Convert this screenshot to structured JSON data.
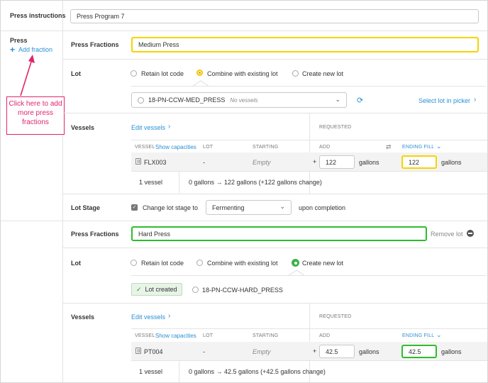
{
  "press_instructions": {
    "label": "Press instructions",
    "value": "Press Program 7"
  },
  "press": {
    "label": "Press",
    "add_fraction": "Add fraction"
  },
  "callout": {
    "text": "Click here to add more press fractions"
  },
  "fraction1": {
    "label": "Press Fractions",
    "value": "Medium Press",
    "lot_label": "Lot",
    "lot_options": [
      "Retain lot code",
      "Combine with existing lot",
      "Create new lot"
    ],
    "lot_select": "18-PN-CCW-MED_PRESS",
    "lot_select_note": "No vessels",
    "select_in_picker": "Select lot in picker",
    "vessels_label": "Vessels",
    "edit_vessels": "Edit vessels",
    "requested": "REQUESTED",
    "headers": {
      "vessel": "VESSEL",
      "show_capacities": "Show capacities",
      "lot": "LOT",
      "starting": "STARTING",
      "add": "ADD",
      "ending_fill": "ENDING FILL"
    },
    "row": {
      "vessel": "FLX003",
      "lot": "-",
      "starting": "Empty",
      "plus": "+",
      "add": "122",
      "add_unit": "gallons",
      "ending": "122",
      "ending_unit": "gallons"
    },
    "summary": {
      "count": "1 vessel",
      "change": "0 gallons → 122 gallons (+122 gallons change)"
    },
    "lot_stage_label": "Lot Stage",
    "change_stage": "Change lot stage to",
    "stage_value": "Fermenting",
    "upon_completion": "upon completion"
  },
  "fraction2": {
    "label": "Press Fractions",
    "value": "Hard Press",
    "remove_lot": "Remove lot",
    "lot_label": "Lot",
    "lot_options": [
      "Retain lot code",
      "Combine with existing lot",
      "Create new lot"
    ],
    "lot_created": "Lot created",
    "lot_code": "18-PN-CCW-HARD_PRESS",
    "vessels_label": "Vessels",
    "edit_vessels": "Edit vessels",
    "requested": "REQUESTED",
    "headers": {
      "vessel": "VESSEL",
      "show_capacities": "Show capacities",
      "lot": "LOT",
      "starting": "STARTING",
      "add": "ADD",
      "ending_fill": "ENDING FILL"
    },
    "row": {
      "vessel": "PT004",
      "lot": "-",
      "starting": "Empty",
      "plus": "+",
      "add": "42.5",
      "add_unit": "gallons",
      "ending": "42.5",
      "ending_unit": "gallons"
    },
    "summary": {
      "count": "1 vessel",
      "change": "0 gallons → 42.5 gallons (+42.5 gallons change)"
    }
  },
  "colors": {
    "accent": "#2a8fd6",
    "yellow_highlight": "#f5d400",
    "green_highlight": "#2dbd2d",
    "callout": "#e0256b"
  }
}
